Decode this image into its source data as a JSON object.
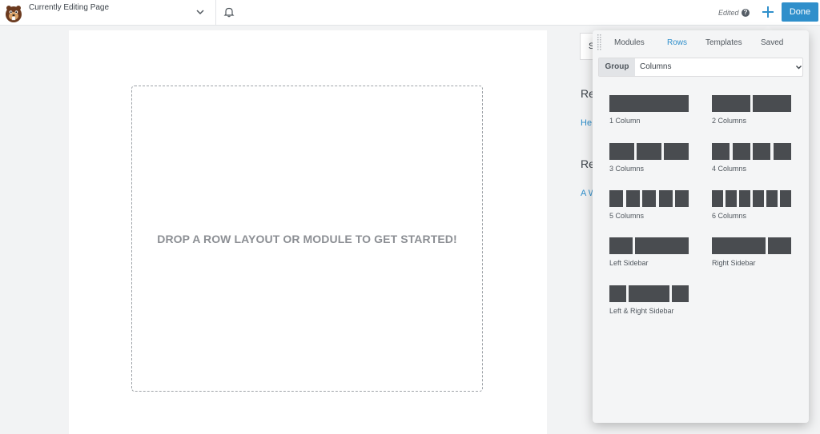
{
  "topbar": {
    "page_title": "Currently Editing Page",
    "edited_label": "Edited",
    "help_glyph": "?",
    "done_label": "Done",
    "accent_color": "#2f8fcb"
  },
  "canvas": {
    "drop_message": "DROP A ROW LAYOUT OR MODULE TO GET STARTED!"
  },
  "sidebar_fragments": {
    "box_letter": "S",
    "heading_1": "Re",
    "link_1": "He",
    "heading_2": "Re",
    "link_2": "A W"
  },
  "panel": {
    "tabs": [
      {
        "label": "Modules",
        "active": false
      },
      {
        "label": "Rows",
        "active": true
      },
      {
        "label": "Templates",
        "active": false
      },
      {
        "label": "Saved",
        "active": false
      }
    ],
    "group_label": "Group",
    "group_value": "Columns",
    "layouts": [
      {
        "label": "1 Column"
      },
      {
        "label": "2 Columns"
      },
      {
        "label": "3 Columns"
      },
      {
        "label": "4 Columns"
      },
      {
        "label": "5 Columns"
      },
      {
        "label": "6 Columns"
      },
      {
        "label": "Left Sidebar"
      },
      {
        "label": "Right Sidebar"
      },
      {
        "label": "Left & Right Sidebar"
      }
    ]
  },
  "icons": [
    "beaver-logo-icon",
    "chevron-down-icon",
    "bell-icon",
    "help-icon",
    "plus-icon",
    "drag-grip-icon",
    "select-chevron-icon"
  ]
}
